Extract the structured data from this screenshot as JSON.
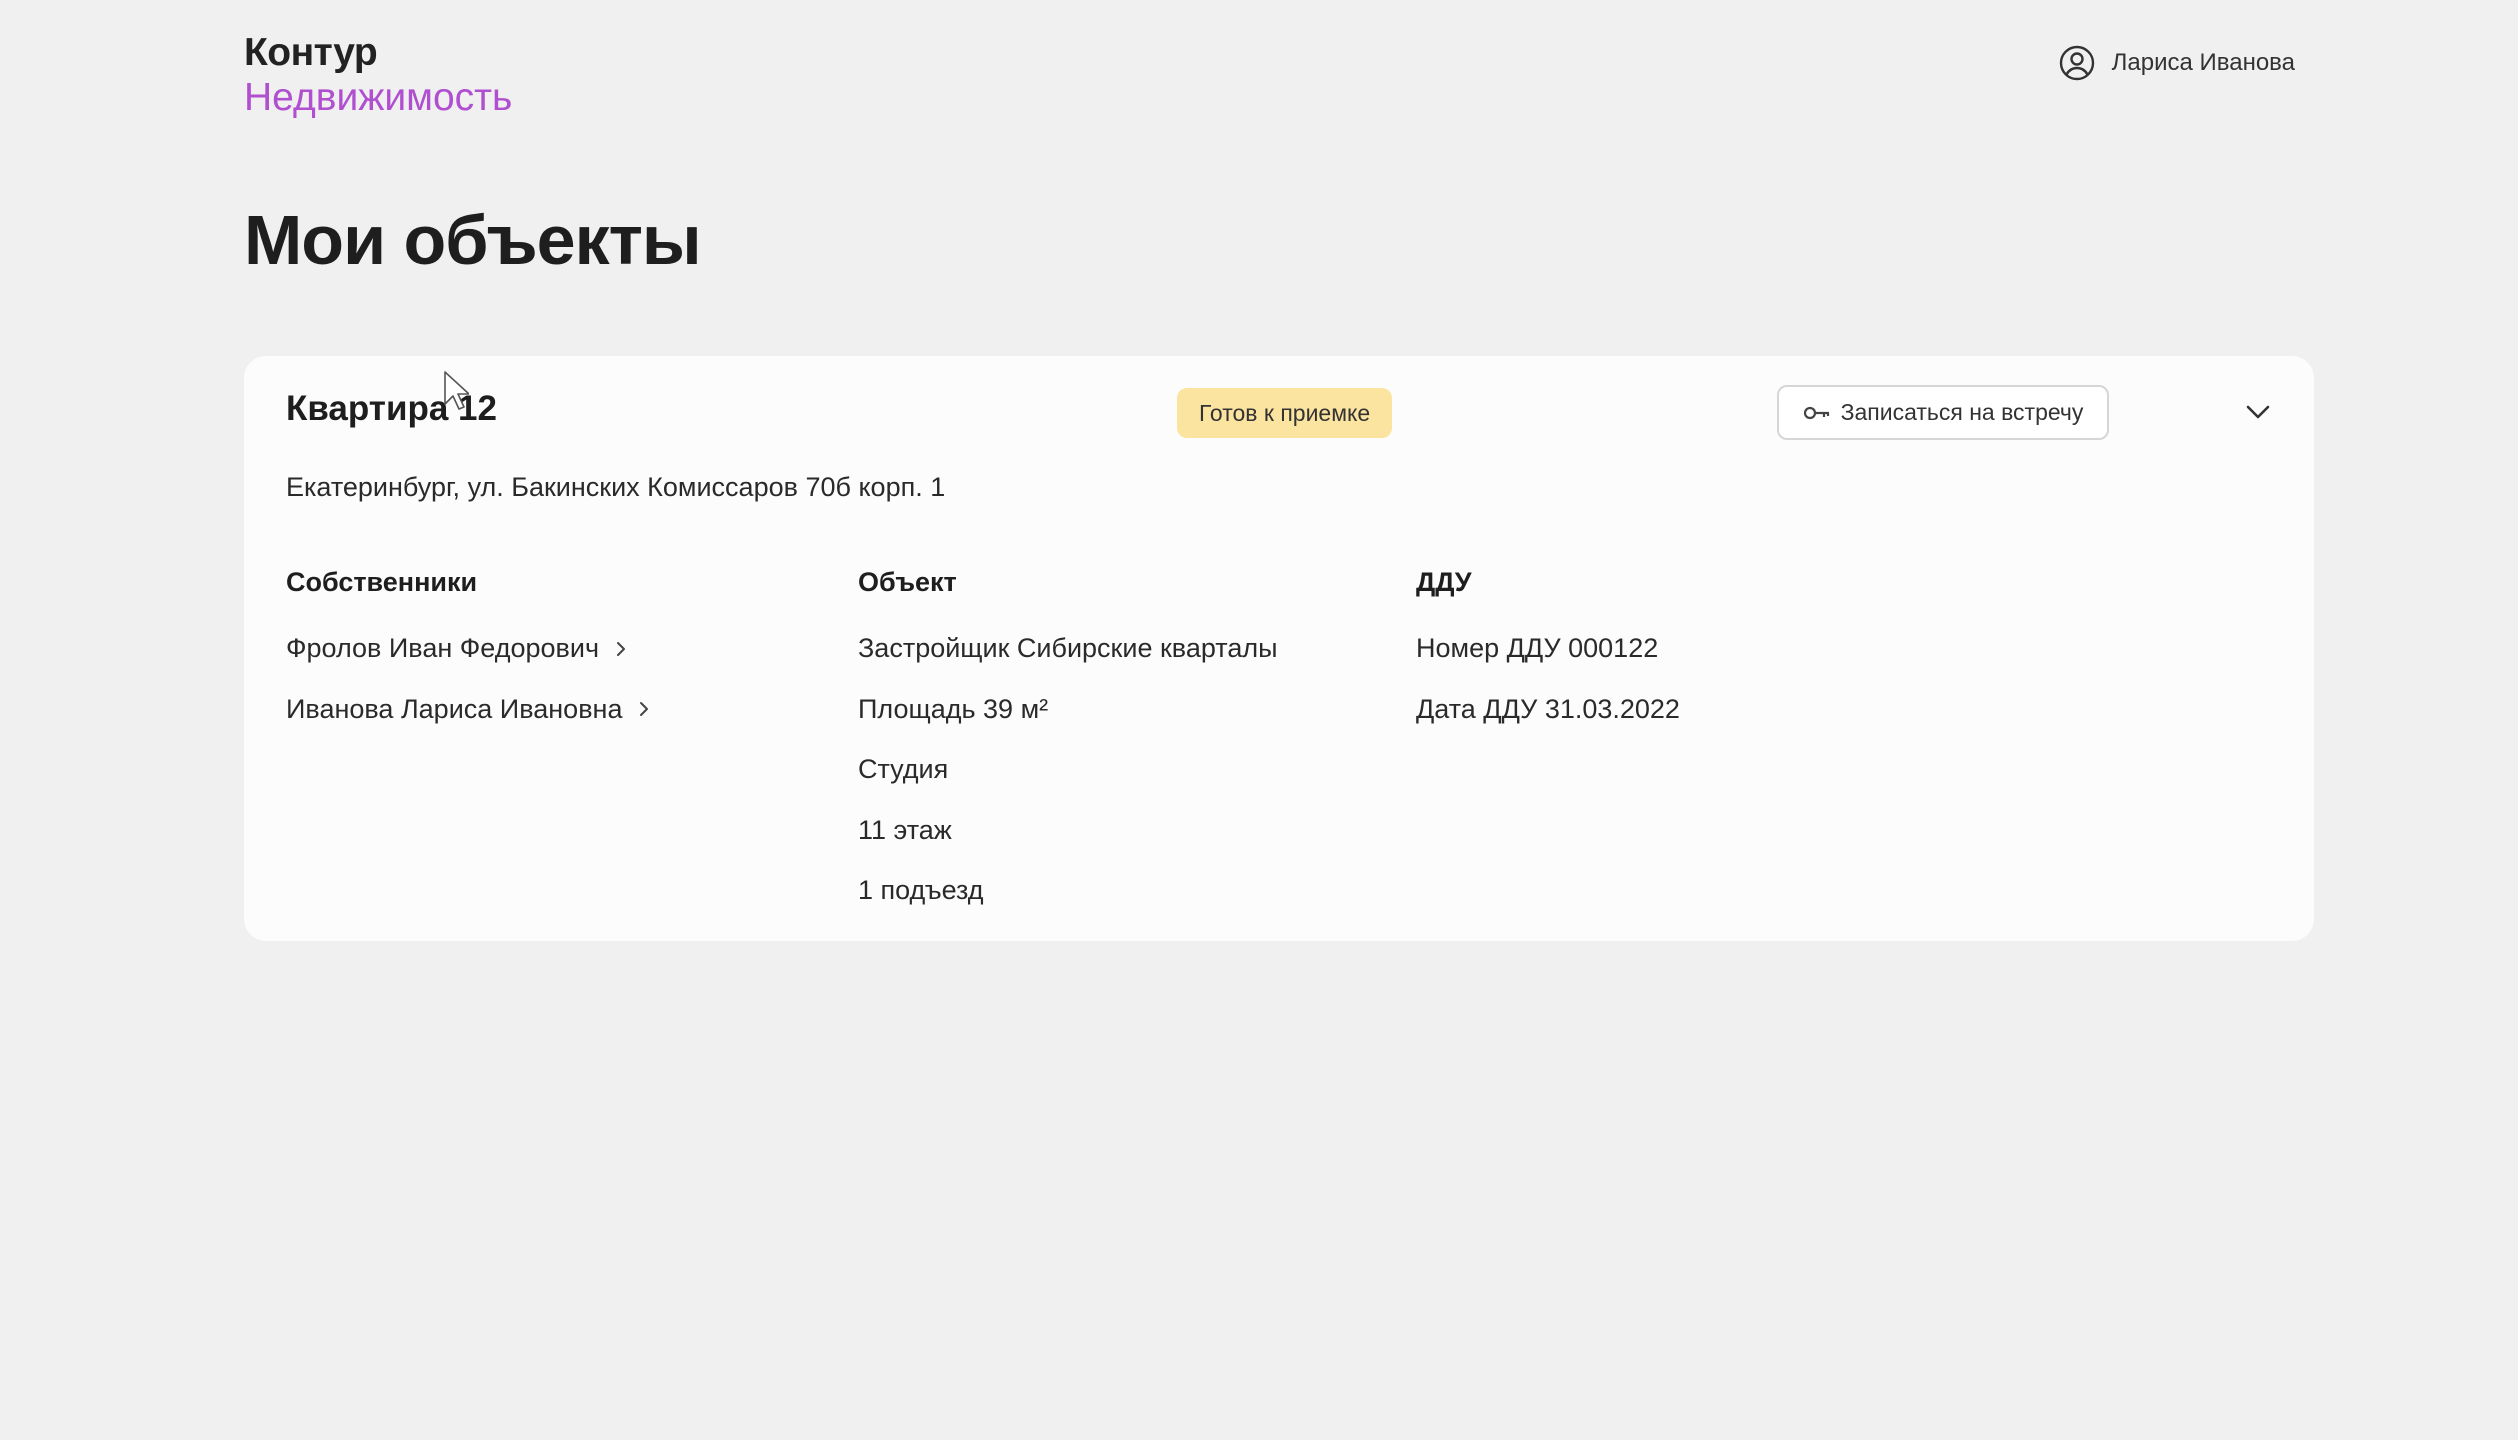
{
  "header": {
    "logo_brand": "Контур",
    "logo_product": "Недвижимость",
    "user_name": "Лариса Иванова",
    "user_icon": "user-circle-icon"
  },
  "page": {
    "title": "Мои объекты"
  },
  "card": {
    "title": "Квартира 12",
    "status": "Готов к приемке",
    "meeting_button": "Записаться на встречу",
    "meeting_icon": "key-icon",
    "expand_icon": "chevron-down-icon",
    "address": "Екатеринбург, ул. Бакинских Комиссаров 70б корп. 1",
    "owners": {
      "header": "Собственники",
      "items": [
        "Фролов Иван Федорович",
        "Иванова Лариса Ивановна"
      ]
    },
    "object": {
      "header": "Объект",
      "items": [
        "Застройщик Сибирские кварталы",
        "Площадь 39 м²",
        "Студия",
        "11 этаж",
        "1 подъезд"
      ]
    },
    "ddu": {
      "header": "ДДУ",
      "items": [
        "Номер ДДУ 000122",
        "Дата ДДУ 31.03.2022"
      ]
    }
  },
  "colors": {
    "background": "#f0f0f0",
    "card": "#fcfcfc",
    "brand_accent": "#b04fd0",
    "status_badge": "#fbe3a0"
  }
}
